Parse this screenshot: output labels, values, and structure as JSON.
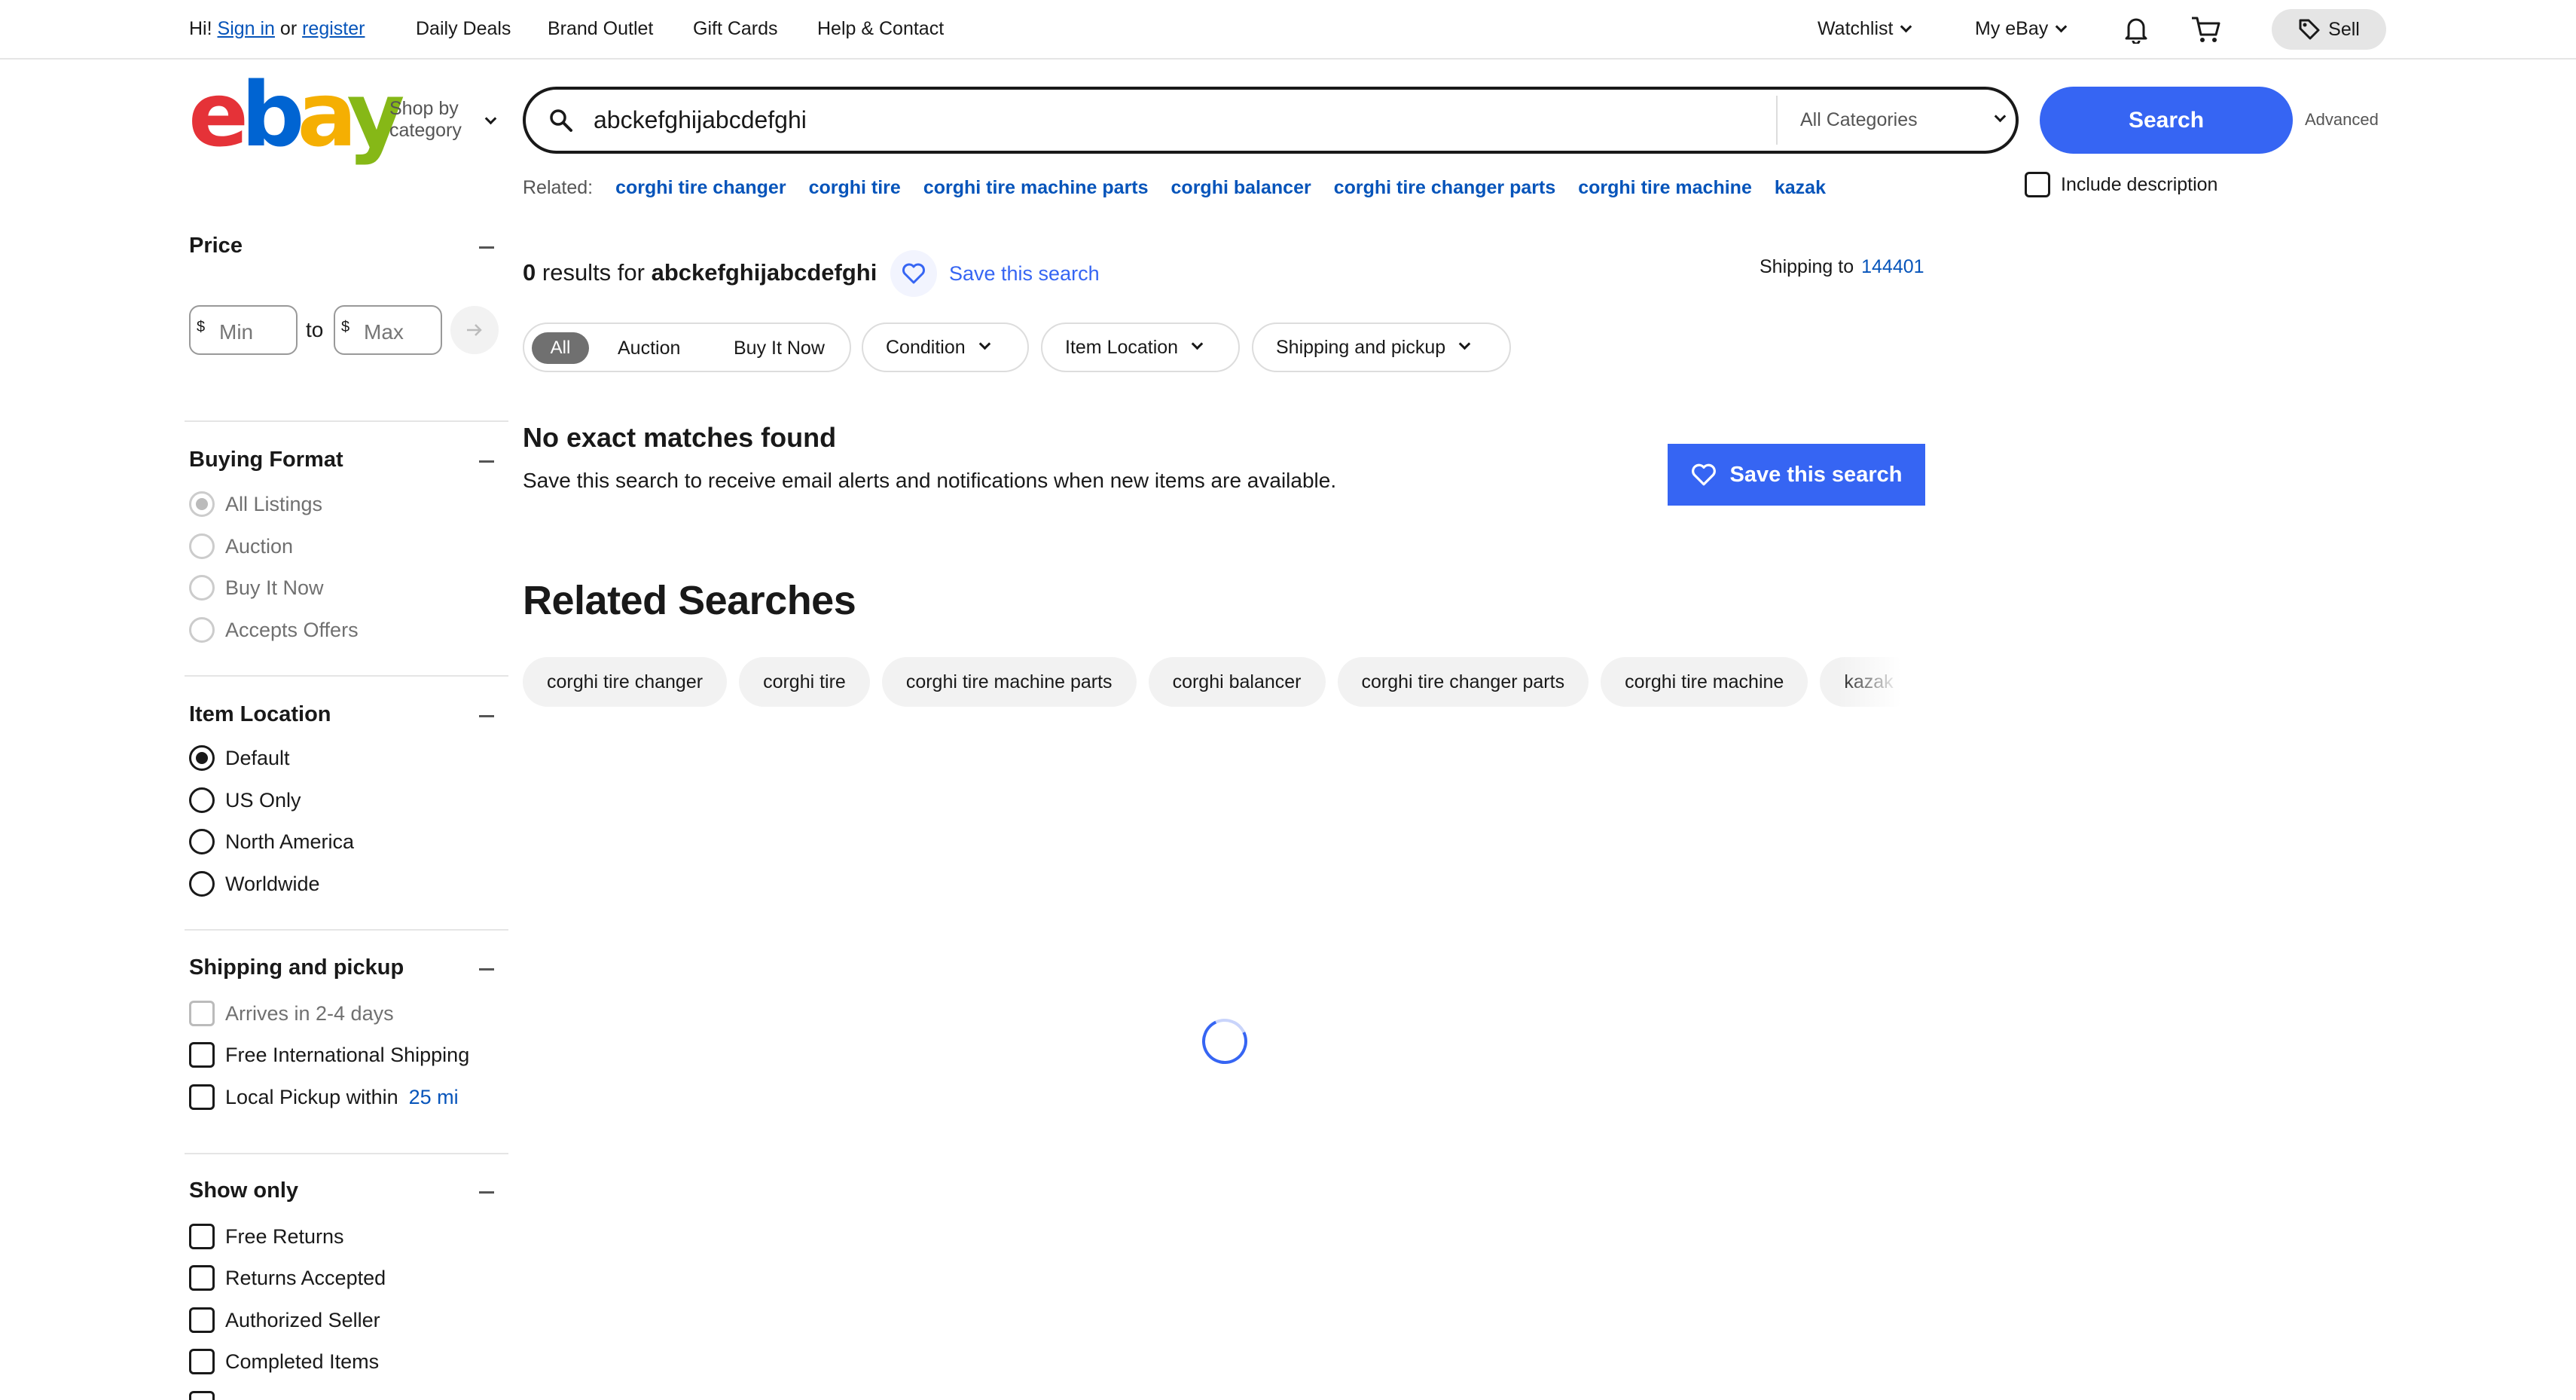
{
  "topbar": {
    "greeting_prefix": "Hi!",
    "sign_in": "Sign in",
    "or": "or",
    "register": "register",
    "links": [
      "Daily Deals",
      "Brand Outlet",
      "Gift Cards",
      "Help & Contact"
    ],
    "watchlist": "Watchlist",
    "my_ebay": "My eBay",
    "sell": "Sell",
    "icons": [
      "notification-bell-icon",
      "cart-icon",
      "tag-icon"
    ]
  },
  "header": {
    "logo_letters": [
      "e",
      "b",
      "a",
      "y"
    ],
    "shop_by_line1": "Shop by",
    "shop_by_line2": "category",
    "search_value": "abckefghijabcdefghi",
    "category": "All Categories",
    "search_button": "Search",
    "advanced": "Advanced",
    "include_description": "Include description",
    "brand_colors": [
      "#e53238",
      "#0064d2",
      "#f5af02",
      "#86b817"
    ],
    "accent": "#3665f3"
  },
  "related_top": {
    "label": "Related:",
    "links": [
      "corghi tire changer",
      "corghi tire",
      "corghi tire machine parts",
      "corghi balancer",
      "corghi tire changer parts",
      "corghi tire machine",
      "kazak"
    ]
  },
  "sidebar": {
    "price": {
      "title": "Price",
      "currency": "$",
      "min_placeholder": "Min",
      "to": "to",
      "max_placeholder": "Max"
    },
    "buying_format": {
      "title": "Buying Format",
      "options": [
        "All Listings",
        "Auction",
        "Buy It Now",
        "Accepts Offers"
      ],
      "selected": "All Listings"
    },
    "item_location": {
      "title": "Item Location",
      "options": [
        "Default",
        "US Only",
        "North America",
        "Worldwide"
      ],
      "selected": "Default"
    },
    "shipping": {
      "title": "Shipping and pickup",
      "arrives": "Arrives in 2-4 days",
      "free_intl": "Free International Shipping",
      "local_pickup": "Local Pickup within",
      "distance": "25 mi"
    },
    "show_only": {
      "title": "Show only",
      "options": [
        "Free Returns",
        "Returns Accepted",
        "Authorized Seller",
        "Completed Items"
      ]
    }
  },
  "main": {
    "results_count": "0",
    "results_for": "results for",
    "query": "abckefghijabcdefghi",
    "save_this_search": "Save this search",
    "shipping_to": "Shipping to",
    "zip": "144401",
    "format_tabs": [
      "All",
      "Auction",
      "Buy It Now"
    ],
    "filters": [
      "Condition",
      "Item Location",
      "Shipping and pickup"
    ],
    "no_match_title": "No exact matches found",
    "no_match_sub": "Save this search to receive email alerts and notifications when new items are available.",
    "save_button": "Save this search",
    "related_heading": "Related Searches",
    "related_chips": [
      "corghi tire changer",
      "corghi tire",
      "corghi tire machine parts",
      "corghi balancer",
      "corghi tire changer parts",
      "corghi tire machine",
      "kazak"
    ]
  }
}
